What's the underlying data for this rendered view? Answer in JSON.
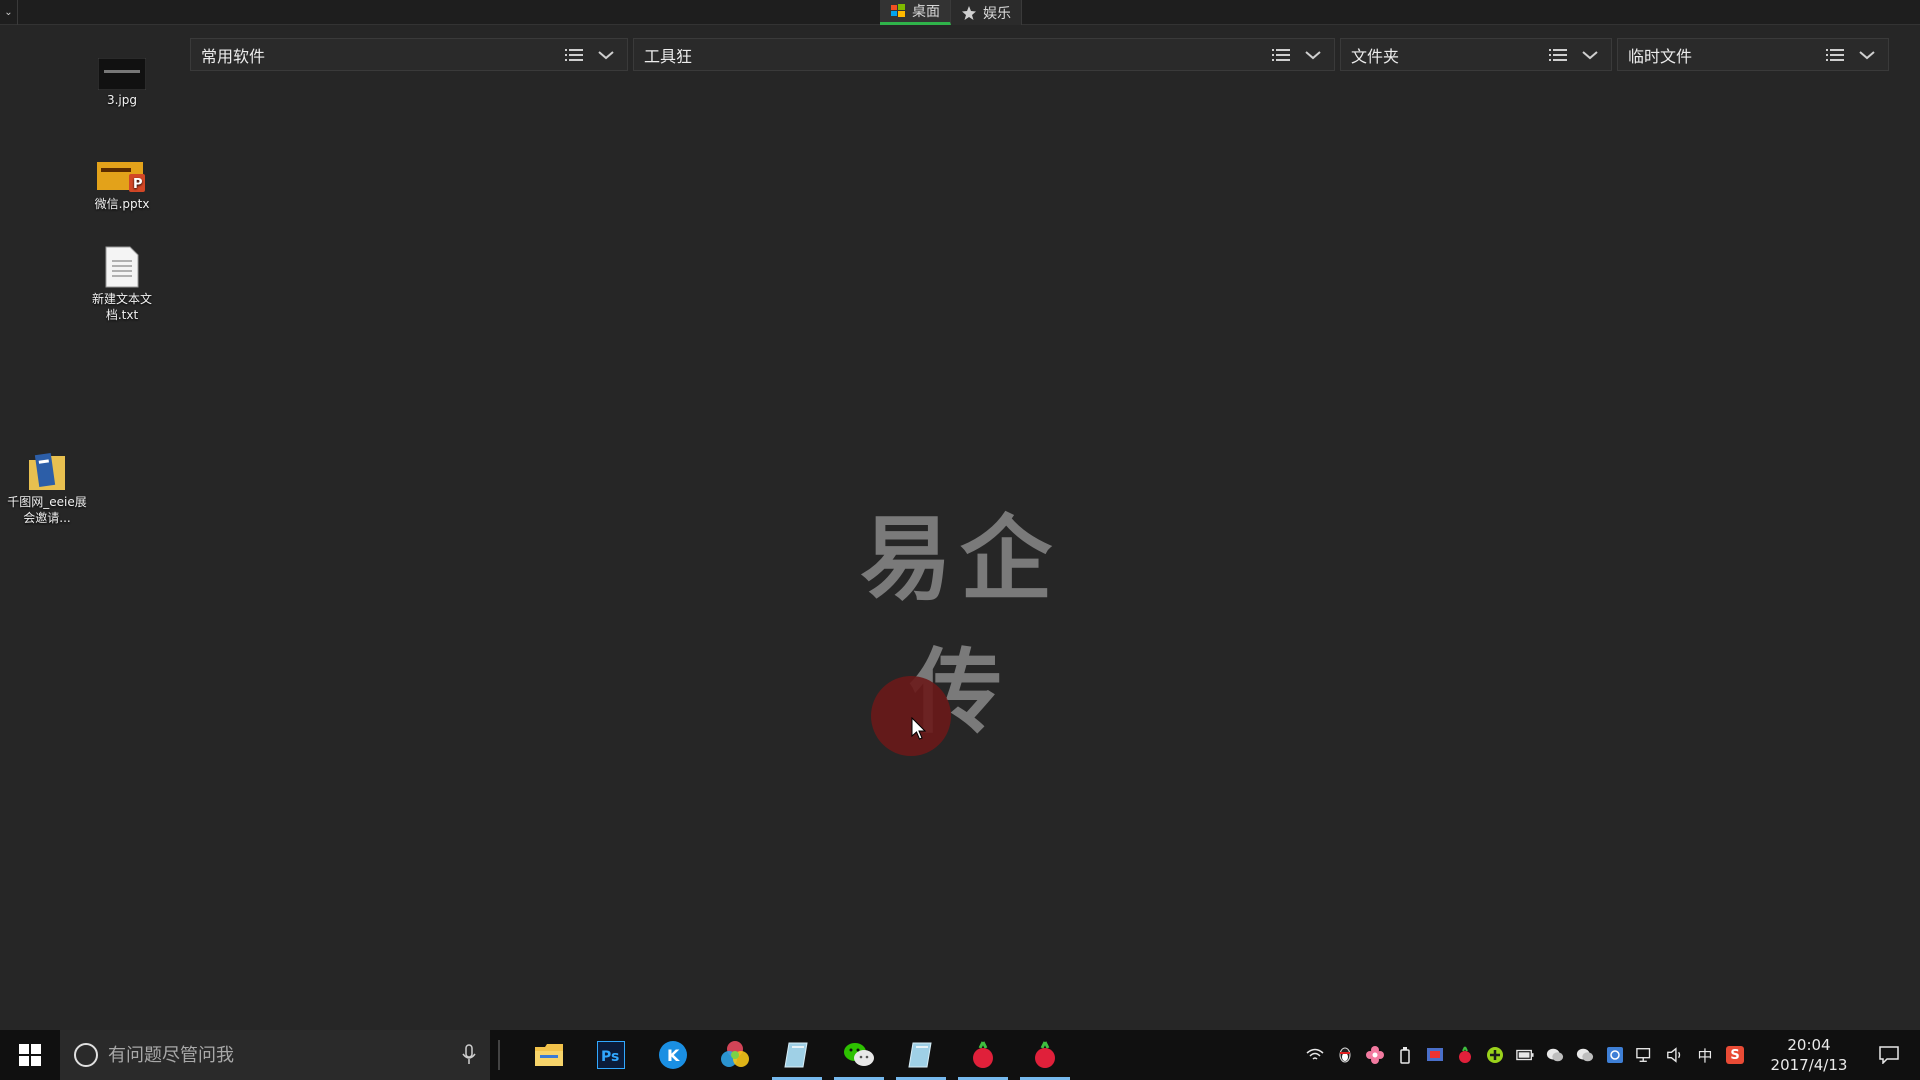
{
  "top_tabs": [
    {
      "label": "桌面",
      "icon": "windows-flag-icon",
      "active": true
    },
    {
      "label": "娱乐",
      "icon": "star-icon",
      "active": false
    }
  ],
  "corner": {
    "icon": "chevron-down-icon",
    "glyph": "⌄"
  },
  "fences": [
    {
      "title": "常用软件"
    },
    {
      "title": "工具狂"
    },
    {
      "title": "文件夹"
    },
    {
      "title": "临时文件"
    }
  ],
  "desktop_icons": [
    {
      "label": "3.jpg",
      "icon": "image-file-icon"
    },
    {
      "label": "微信.pptx",
      "icon": "pptx-file-icon"
    },
    {
      "label": "新建文本文档.txt",
      "icon": "text-file-icon"
    },
    {
      "label": "千图网_eeie展会邀请...",
      "icon": "folder-icon"
    }
  ],
  "watermark": "易企传",
  "taskbar": {
    "search_placeholder": "有问题尽管问我",
    "apps": [
      {
        "name": "file-explorer-icon",
        "running": false
      },
      {
        "name": "photoshop-icon",
        "text": "Ps",
        "running": false
      },
      {
        "name": "kugou-icon",
        "text": "K",
        "running": false
      },
      {
        "name": "color-wheel-app-icon",
        "running": false
      },
      {
        "name": "notes-app-icon",
        "running": true
      },
      {
        "name": "wechat-icon",
        "running": true
      },
      {
        "name": "notes-app-icon-2",
        "running": true
      },
      {
        "name": "radish-app-icon",
        "running": true
      },
      {
        "name": "radish-app-icon-2",
        "running": true
      }
    ],
    "tray_ime": "中",
    "tray_sogou": "S",
    "clock_time": "20:04",
    "clock_date": "2017/4/13"
  },
  "colors": {
    "desktop_bg": "#262626",
    "taskbar_bg": "#101010",
    "active_tab_accent": "#2fb34a",
    "running_indicator": "#76b9ed",
    "cursor_halo": "#6a1a1a"
  }
}
